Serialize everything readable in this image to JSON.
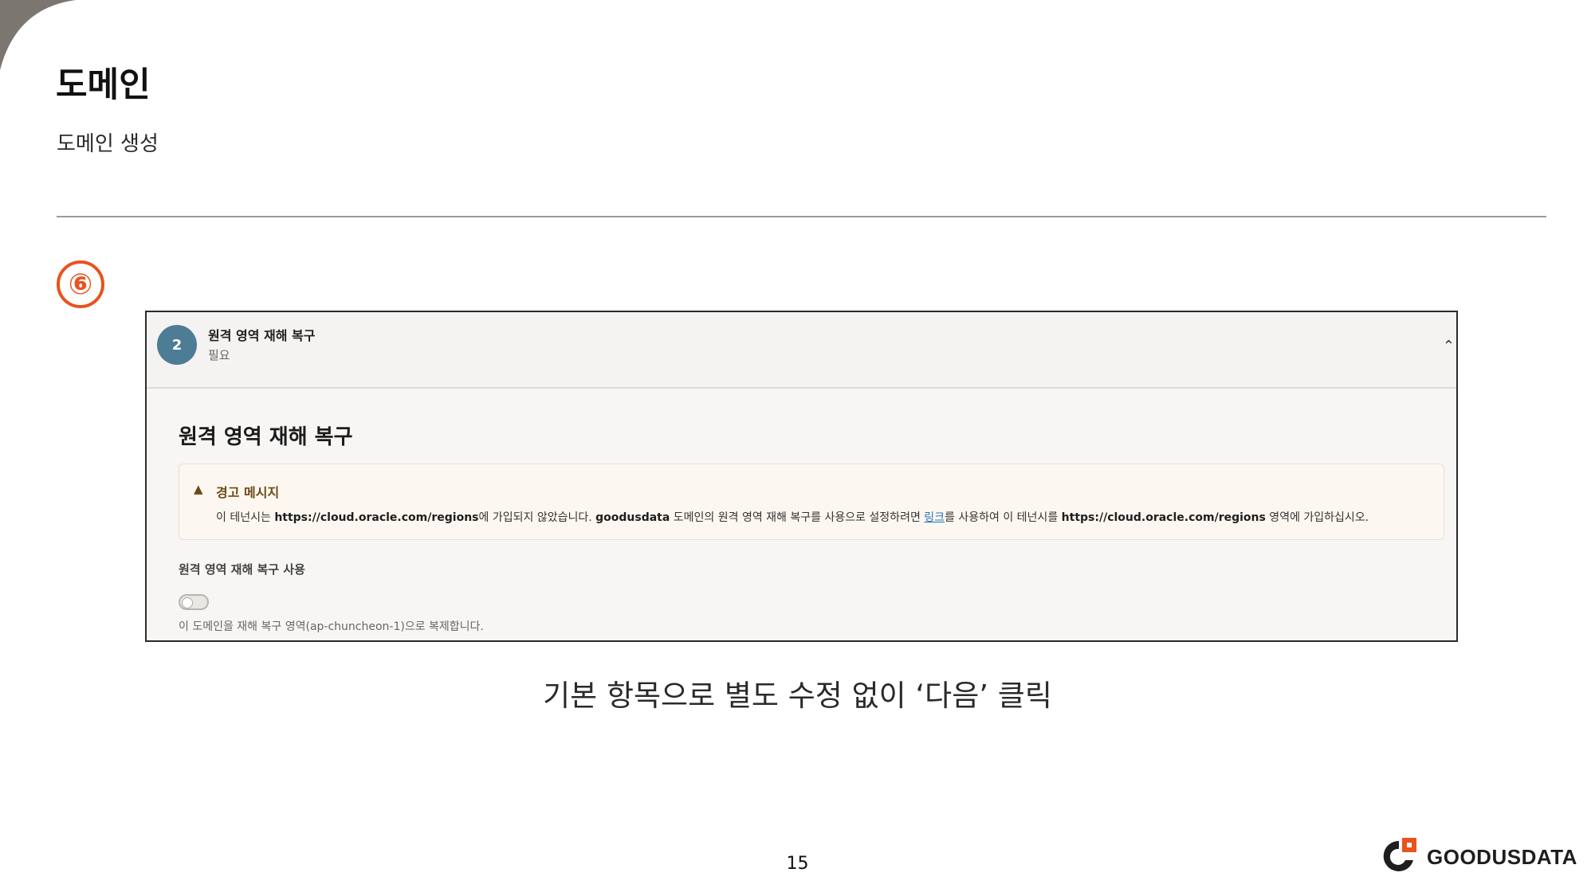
{
  "slide": {
    "title": "도메인",
    "subtitle": "도메인 생성",
    "step_marker": "⑥",
    "caption": "기본 항목으로 별도 수정 없이 ‘다음’ 클릭",
    "page_number": "15",
    "logo_text": "GOODUSDATA"
  },
  "panel": {
    "step_number": "2",
    "header_title": "원격 영역 재해 복구",
    "header_status": "필요",
    "section_title": "원격 영역 재해 복구",
    "warning": {
      "title": "경고 메시지",
      "text_1": "이 테넌시는 ",
      "url_1": "https://cloud.oracle.com/regions",
      "text_2": "에 가입되지 않았습니다. ",
      "domain_name": "goodusdata",
      "text_3": " 도메인의 원격 영역 재해 복구를 사용으로 설정하려면 ",
      "link_label": "링크",
      "text_4": "를 사용하여 이 테넌시를 ",
      "url_2": "https://cloud.oracle.com/regions",
      "text_5": " 영역에 가입하십시오."
    },
    "toggle_label": "원격 영역 재해 복구 사용",
    "toggle_enabled": false,
    "toggle_help": "이 도메인을 재해 복구 영역(ap-chuncheon-1)으로 복제합니다."
  },
  "colors": {
    "accent": "#e8531e",
    "step_badge": "#4d7c95",
    "warning_text": "#6b4a16",
    "link": "#2a6ebb"
  },
  "icons": {
    "warning": "warning-triangle-icon",
    "collapse": "chevron-up-icon"
  }
}
